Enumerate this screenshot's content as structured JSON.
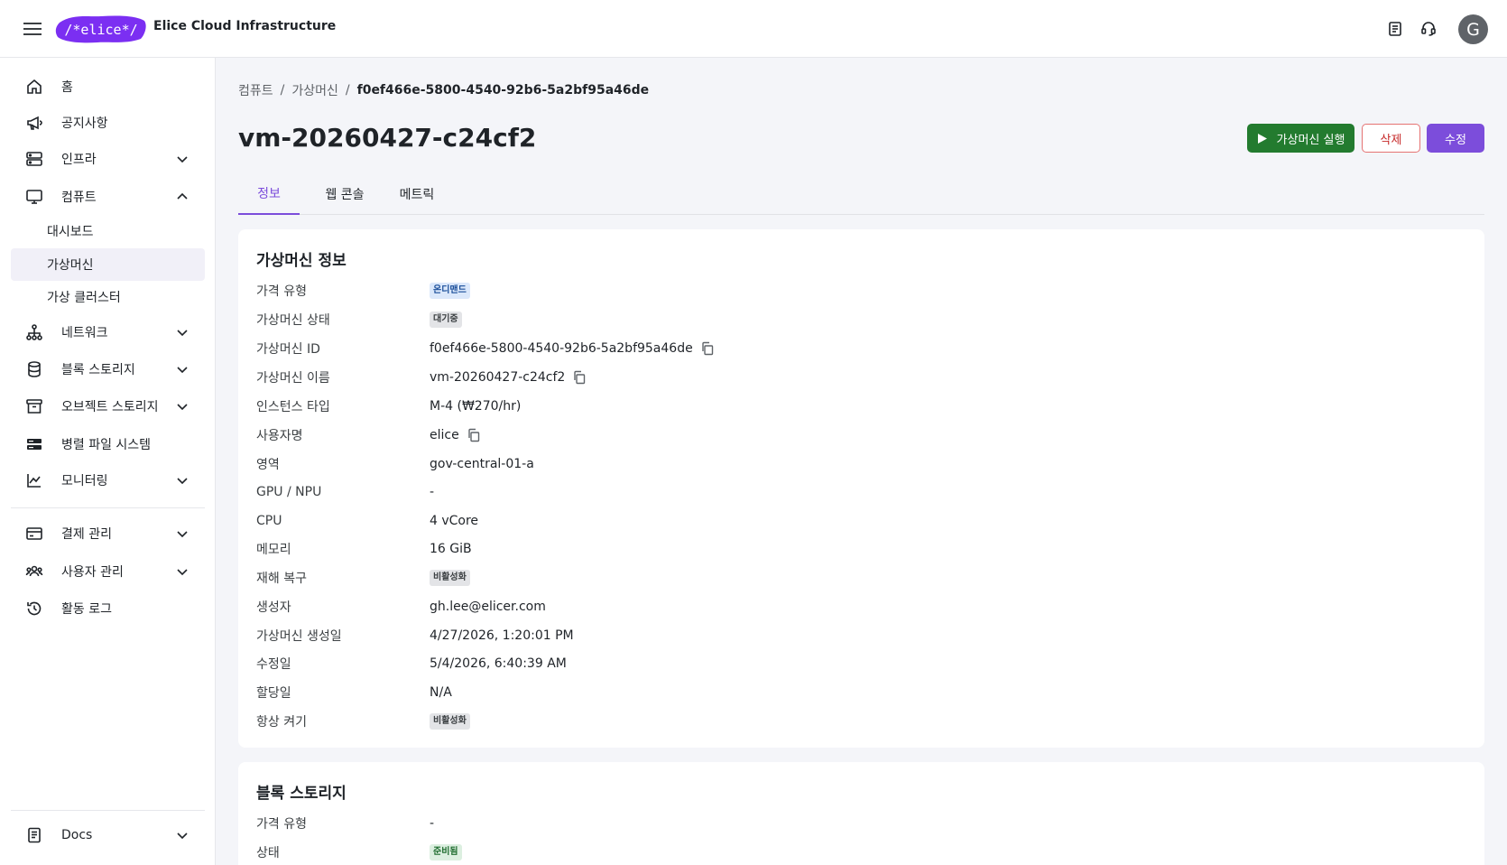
{
  "header": {
    "logo_text": "/*elice*/",
    "app_title": "Elice Cloud Infrastructure",
    "avatar_letter": "G"
  },
  "sidebar": {
    "items": [
      {
        "label": "홈",
        "icon": "home-icon"
      },
      {
        "label": "공지사항",
        "icon": "megaphone-icon"
      },
      {
        "label": "인프라",
        "icon": "server-icon"
      },
      {
        "label": "컴퓨트",
        "icon": "monitor-icon"
      },
      {
        "label": "네트워크",
        "icon": "network-icon"
      },
      {
        "label": "블록 스토리지",
        "icon": "database-icon"
      },
      {
        "label": "오브젝트 스토리지",
        "icon": "archive-icon"
      },
      {
        "label": "병렬 파일 시스템",
        "icon": "storage-icon"
      },
      {
        "label": "모니터링",
        "icon": "chart-line-icon"
      },
      {
        "label": "결제 관리",
        "icon": "credit-card-icon"
      },
      {
        "label": "사용자 관리",
        "icon": "users-icon"
      },
      {
        "label": "활동 로그",
        "icon": "history-icon"
      },
      {
        "label": "Docs",
        "icon": "book-icon"
      }
    ],
    "compute_sub": [
      "대시보드",
      "가상머신",
      "가상 클러스터"
    ]
  },
  "breadcrumb": {
    "items": [
      "컴퓨트",
      "가상머신"
    ],
    "current": "f0ef466e-5800-4540-92b6-5a2bf95a46de",
    "separator": "/"
  },
  "page": {
    "title": "vm-20260427-c24cf2"
  },
  "actions": {
    "run_label": "가상머신 실행",
    "delete_label": "삭제",
    "edit_label": "수정"
  },
  "tabs": [
    "정보",
    "웹 콘솔",
    "메트릭"
  ],
  "vm_info": {
    "title": "가상머신 정보",
    "rows": [
      {
        "key": "가격 유형",
        "value": "온디맨드",
        "kind": "badge-blue"
      },
      {
        "key": "가상머신 상태",
        "value": "대기중",
        "kind": "badge-gray"
      },
      {
        "key": "가상머신 ID",
        "value": "f0ef466e-5800-4540-92b6-5a2bf95a46de",
        "kind": "copy"
      },
      {
        "key": "가상머신 이름",
        "value": "vm-20260427-c24cf2",
        "kind": "copy"
      },
      {
        "key": "인스턴스 타입",
        "value": "M-4 (₩270/hr)",
        "kind": "text"
      },
      {
        "key": "사용자명",
        "value": "elice",
        "kind": "copy"
      },
      {
        "key": "영역",
        "value": "gov-central-01-a",
        "kind": "text"
      },
      {
        "key": "GPU / NPU",
        "value": "-",
        "kind": "text"
      },
      {
        "key": "CPU",
        "value": "4 vCore",
        "kind": "text"
      },
      {
        "key": "메모리",
        "value": "16 GiB",
        "kind": "text"
      },
      {
        "key": "재해 복구",
        "value": "비활성화",
        "kind": "badge-gray"
      },
      {
        "key": "생성자",
        "value": "gh.lee@elicer.com",
        "kind": "text"
      },
      {
        "key": "가상머신 생성일",
        "value": "4/27/2026, 1:20:01 PM",
        "kind": "text"
      },
      {
        "key": "수정일",
        "value": "5/4/2026, 6:40:39 AM",
        "kind": "text"
      },
      {
        "key": "할당일",
        "value": "N/A",
        "kind": "text"
      },
      {
        "key": "항상 켜기",
        "value": "비활성화",
        "kind": "badge-gray"
      }
    ]
  },
  "block_storage": {
    "title": "블록 스토리지",
    "rows": [
      {
        "key": "가격 유형",
        "value": "-",
        "kind": "text"
      },
      {
        "key": "상태",
        "value": "준비됨",
        "kind": "badge-green"
      }
    ]
  },
  "colors": {
    "accent": "#7c4ddb",
    "run_green": "#237b2f",
    "danger": "#c62828"
  }
}
